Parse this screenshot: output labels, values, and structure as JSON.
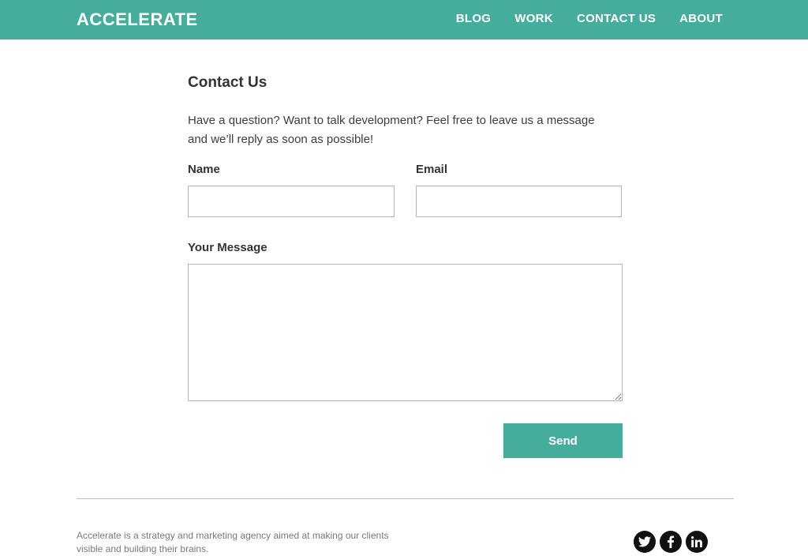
{
  "header": {
    "logo": "ACCELERATE",
    "nav": [
      "BLOG",
      "WORK",
      "CONTACT US",
      "ABOUT"
    ]
  },
  "main": {
    "title": "Contact Us",
    "intro": "Have a question? Want to talk development? Feel free to leave us a message and we’ll reply as soon as possible!",
    "form": {
      "name_label": "Name",
      "name_value": "",
      "email_label": "Email",
      "email_value": "",
      "message_label": "Your Message",
      "message_value": "",
      "send_label": "Send"
    }
  },
  "footer": {
    "text": "Accelerate is a strategy and marketing agency aimed at making our clients visible and building their brains.",
    "social_icons": [
      "twitter-icon",
      "facebook-icon",
      "linkedin-icon"
    ]
  },
  "colors": {
    "accent": "#46ac9c",
    "text": "#333333"
  }
}
